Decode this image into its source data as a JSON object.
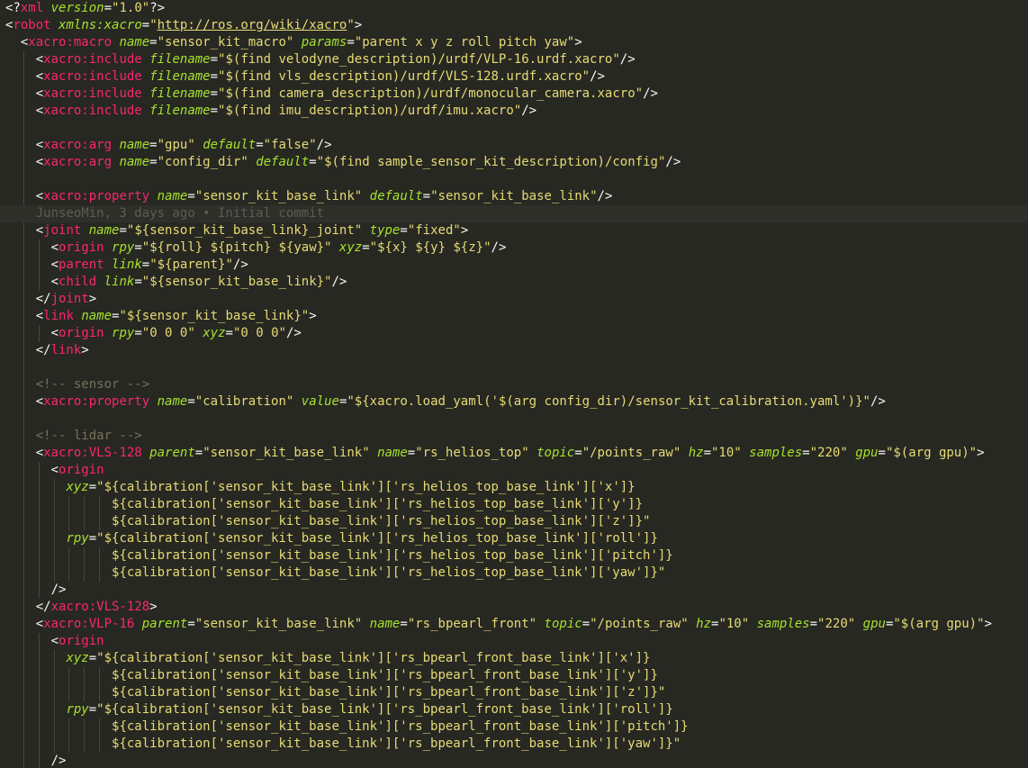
{
  "editor": {
    "file_type": "xacro",
    "colors": {
      "background": "#272822",
      "punctuation": "#f8f8f2",
      "tag": "#f92672",
      "attribute": "#a6e22e",
      "string": "#e6db74",
      "comment": "#75715e"
    },
    "lines": [
      {
        "indent": 0,
        "tokens": [
          [
            "pu",
            "<?"
          ],
          [
            "tag",
            "xml"
          ],
          [
            "pu",
            " "
          ],
          [
            "attr",
            "version"
          ],
          [
            "pu",
            "="
          ],
          [
            "str",
            "\"1.0\""
          ],
          [
            "pu",
            "?>"
          ]
        ]
      },
      {
        "indent": 0,
        "tokens": [
          [
            "pu",
            "<"
          ],
          [
            "tag",
            "robot"
          ],
          [
            "pu",
            " "
          ],
          [
            "attr",
            "xmlns:xacro"
          ],
          [
            "pu",
            "="
          ],
          [
            "str",
            "\""
          ],
          [
            "url",
            "http://ros.org/wiki/xacro"
          ],
          [
            "str",
            "\""
          ],
          [
            "pu",
            ">"
          ]
        ]
      },
      {
        "indent": 1,
        "tokens": [
          [
            "pu",
            "<"
          ],
          [
            "tag",
            "xacro:macro"
          ],
          [
            "pu",
            " "
          ],
          [
            "attr",
            "name"
          ],
          [
            "pu",
            "="
          ],
          [
            "str",
            "\"sensor_kit_macro\""
          ],
          [
            "pu",
            " "
          ],
          [
            "attr",
            "params"
          ],
          [
            "pu",
            "="
          ],
          [
            "str",
            "\"parent x y z roll pitch yaw\""
          ],
          [
            "pu",
            ">"
          ]
        ]
      },
      {
        "indent": 2,
        "tokens": [
          [
            "pu",
            "<"
          ],
          [
            "tag",
            "xacro:include"
          ],
          [
            "pu",
            " "
          ],
          [
            "attr",
            "filename"
          ],
          [
            "pu",
            "="
          ],
          [
            "str",
            "\"$(find velodyne_description)/urdf/VLP-16.urdf.xacro\""
          ],
          [
            "pu",
            "/>"
          ]
        ]
      },
      {
        "indent": 2,
        "tokens": [
          [
            "pu",
            "<"
          ],
          [
            "tag",
            "xacro:include"
          ],
          [
            "pu",
            " "
          ],
          [
            "attr",
            "filename"
          ],
          [
            "pu",
            "="
          ],
          [
            "str",
            "\"$(find vls_description)/urdf/VLS-128.urdf.xacro\""
          ],
          [
            "pu",
            "/>"
          ]
        ]
      },
      {
        "indent": 2,
        "tokens": [
          [
            "pu",
            "<"
          ],
          [
            "tag",
            "xacro:include"
          ],
          [
            "pu",
            " "
          ],
          [
            "attr",
            "filename"
          ],
          [
            "pu",
            "="
          ],
          [
            "str",
            "\"$(find camera_description)/urdf/monocular_camera.xacro\""
          ],
          [
            "pu",
            "/>"
          ]
        ]
      },
      {
        "indent": 2,
        "tokens": [
          [
            "pu",
            "<"
          ],
          [
            "tag",
            "xacro:include"
          ],
          [
            "pu",
            " "
          ],
          [
            "attr",
            "filename"
          ],
          [
            "pu",
            "="
          ],
          [
            "str",
            "\"$(find imu_description)/urdf/imu.xacro\""
          ],
          [
            "pu",
            "/>"
          ]
        ]
      },
      {
        "indent": 2,
        "tokens": []
      },
      {
        "indent": 2,
        "tokens": [
          [
            "pu",
            "<"
          ],
          [
            "tag",
            "xacro:arg"
          ],
          [
            "pu",
            " "
          ],
          [
            "attr",
            "name"
          ],
          [
            "pu",
            "="
          ],
          [
            "str",
            "\"gpu\""
          ],
          [
            "pu",
            " "
          ],
          [
            "attr",
            "default"
          ],
          [
            "pu",
            "="
          ],
          [
            "str",
            "\"false\""
          ],
          [
            "pu",
            "/>"
          ]
        ]
      },
      {
        "indent": 2,
        "tokens": [
          [
            "pu",
            "<"
          ],
          [
            "tag",
            "xacro:arg"
          ],
          [
            "pu",
            " "
          ],
          [
            "attr",
            "name"
          ],
          [
            "pu",
            "="
          ],
          [
            "str",
            "\"config_dir\""
          ],
          [
            "pu",
            " "
          ],
          [
            "attr",
            "default"
          ],
          [
            "pu",
            "="
          ],
          [
            "str",
            "\"$(find sample_sensor_kit_description)/config\""
          ],
          [
            "pu",
            "/>"
          ]
        ]
      },
      {
        "indent": 2,
        "tokens": []
      },
      {
        "indent": 2,
        "tokens": [
          [
            "pu",
            "<"
          ],
          [
            "tag",
            "xacro:property"
          ],
          [
            "pu",
            " "
          ],
          [
            "attr",
            "name"
          ],
          [
            "pu",
            "="
          ],
          [
            "str",
            "\"sensor_kit_base_link\""
          ],
          [
            "pu",
            " "
          ],
          [
            "attr",
            "default"
          ],
          [
            "pu",
            "="
          ],
          [
            "str",
            "\"sensor_kit_base_link\""
          ],
          [
            "pu",
            "/>"
          ]
        ]
      },
      {
        "indent": 1,
        "highlight": true,
        "tokens": [
          [
            "blame",
            "  JunseoMin, 3 days ago • Initial commit"
          ]
        ]
      },
      {
        "indent": 2,
        "tokens": [
          [
            "pu",
            "<"
          ],
          [
            "tag",
            "joint"
          ],
          [
            "pu",
            " "
          ],
          [
            "attr",
            "name"
          ],
          [
            "pu",
            "="
          ],
          [
            "str",
            "\"${sensor_kit_base_link}_joint\""
          ],
          [
            "pu",
            " "
          ],
          [
            "attr",
            "type"
          ],
          [
            "pu",
            "="
          ],
          [
            "str",
            "\"fixed\""
          ],
          [
            "pu",
            ">"
          ]
        ]
      },
      {
        "indent": 3,
        "tokens": [
          [
            "pu",
            "<"
          ],
          [
            "tag",
            "origin"
          ],
          [
            "pu",
            " "
          ],
          [
            "attr",
            "rpy"
          ],
          [
            "pu",
            "="
          ],
          [
            "str",
            "\"${roll} ${pitch} ${yaw}\""
          ],
          [
            "pu",
            " "
          ],
          [
            "attr",
            "xyz"
          ],
          [
            "pu",
            "="
          ],
          [
            "str",
            "\"${x} ${y} ${z}\""
          ],
          [
            "pu",
            "/>"
          ]
        ]
      },
      {
        "indent": 3,
        "tokens": [
          [
            "pu",
            "<"
          ],
          [
            "tag",
            "parent"
          ],
          [
            "pu",
            " "
          ],
          [
            "attr",
            "link"
          ],
          [
            "pu",
            "="
          ],
          [
            "str",
            "\"${parent}\""
          ],
          [
            "pu",
            "/>"
          ]
        ]
      },
      {
        "indent": 3,
        "tokens": [
          [
            "pu",
            "<"
          ],
          [
            "tag",
            "child"
          ],
          [
            "pu",
            " "
          ],
          [
            "attr",
            "link"
          ],
          [
            "pu",
            "="
          ],
          [
            "str",
            "\"${sensor_kit_base_link}\""
          ],
          [
            "pu",
            "/>"
          ]
        ]
      },
      {
        "indent": 2,
        "tokens": [
          [
            "pu",
            "</"
          ],
          [
            "tag",
            "joint"
          ],
          [
            "pu",
            ">"
          ]
        ]
      },
      {
        "indent": 2,
        "tokens": [
          [
            "pu",
            "<"
          ],
          [
            "tag",
            "link"
          ],
          [
            "pu",
            " "
          ],
          [
            "attr",
            "name"
          ],
          [
            "pu",
            "="
          ],
          [
            "str",
            "\"${sensor_kit_base_link}\""
          ],
          [
            "pu",
            ">"
          ]
        ]
      },
      {
        "indent": 3,
        "tokens": [
          [
            "pu",
            "<"
          ],
          [
            "tag",
            "origin"
          ],
          [
            "pu",
            " "
          ],
          [
            "attr",
            "rpy"
          ],
          [
            "pu",
            "="
          ],
          [
            "str",
            "\"0 0 0\""
          ],
          [
            "pu",
            " "
          ],
          [
            "attr",
            "xyz"
          ],
          [
            "pu",
            "="
          ],
          [
            "str",
            "\"0 0 0\""
          ],
          [
            "pu",
            "/>"
          ]
        ]
      },
      {
        "indent": 2,
        "tokens": [
          [
            "pu",
            "</"
          ],
          [
            "tag",
            "link"
          ],
          [
            "pu",
            ">"
          ]
        ]
      },
      {
        "indent": 2,
        "tokens": []
      },
      {
        "indent": 2,
        "tokens": [
          [
            "cmt",
            "<!-- sensor -->"
          ]
        ]
      },
      {
        "indent": 2,
        "tokens": [
          [
            "pu",
            "<"
          ],
          [
            "tag",
            "xacro:property"
          ],
          [
            "pu",
            " "
          ],
          [
            "attr",
            "name"
          ],
          [
            "pu",
            "="
          ],
          [
            "str",
            "\"calibration\""
          ],
          [
            "pu",
            " "
          ],
          [
            "attr",
            "value"
          ],
          [
            "pu",
            "="
          ],
          [
            "str",
            "\"${xacro.load_yaml('$(arg config_dir)/sensor_kit_calibration.yaml')}\""
          ],
          [
            "pu",
            "/>"
          ]
        ]
      },
      {
        "indent": 2,
        "tokens": []
      },
      {
        "indent": 2,
        "tokens": [
          [
            "cmt",
            "<!-- lidar -->"
          ]
        ]
      },
      {
        "indent": 2,
        "tokens": [
          [
            "pu",
            "<"
          ],
          [
            "tag",
            "xacro:VLS-128"
          ],
          [
            "pu",
            " "
          ],
          [
            "attr",
            "parent"
          ],
          [
            "pu",
            "="
          ],
          [
            "str",
            "\"sensor_kit_base_link\""
          ],
          [
            "pu",
            " "
          ],
          [
            "attr",
            "name"
          ],
          [
            "pu",
            "="
          ],
          [
            "str",
            "\"rs_helios_top\""
          ],
          [
            "pu",
            " "
          ],
          [
            "attr",
            "topic"
          ],
          [
            "pu",
            "="
          ],
          [
            "str",
            "\"/points_raw\""
          ],
          [
            "pu",
            " "
          ],
          [
            "attr",
            "hz"
          ],
          [
            "pu",
            "="
          ],
          [
            "str",
            "\"10\""
          ],
          [
            "pu",
            " "
          ],
          [
            "attr",
            "samples"
          ],
          [
            "pu",
            "="
          ],
          [
            "str",
            "\"220\""
          ],
          [
            "pu",
            " "
          ],
          [
            "attr",
            "gpu"
          ],
          [
            "pu",
            "="
          ],
          [
            "str",
            "\"$(arg gpu)\""
          ],
          [
            "pu",
            ">"
          ]
        ]
      },
      {
        "indent": 3,
        "tokens": [
          [
            "pu",
            "<"
          ],
          [
            "tag",
            "origin"
          ]
        ]
      },
      {
        "indent": 4,
        "tokens": [
          [
            "attr",
            "xyz"
          ],
          [
            "pu",
            "="
          ],
          [
            "str",
            "\"${calibration['sensor_kit_base_link']['rs_helios_top_base_link']['x']}"
          ]
        ]
      },
      {
        "indent": 7,
        "tokens": [
          [
            "str",
            "${calibration['sensor_kit_base_link']['rs_helios_top_base_link']['y']}"
          ]
        ]
      },
      {
        "indent": 7,
        "tokens": [
          [
            "str",
            "${calibration['sensor_kit_base_link']['rs_helios_top_base_link']['z']}\""
          ]
        ]
      },
      {
        "indent": 4,
        "tokens": [
          [
            "attr",
            "rpy"
          ],
          [
            "pu",
            "="
          ],
          [
            "str",
            "\"${calibration['sensor_kit_base_link']['rs_helios_top_base_link']['roll']}"
          ]
        ]
      },
      {
        "indent": 7,
        "tokens": [
          [
            "str",
            "${calibration['sensor_kit_base_link']['rs_helios_top_base_link']['pitch']}"
          ]
        ]
      },
      {
        "indent": 7,
        "tokens": [
          [
            "str",
            "${calibration['sensor_kit_base_link']['rs_helios_top_base_link']['yaw']}\""
          ]
        ]
      },
      {
        "indent": 3,
        "tokens": [
          [
            "pu",
            "/>"
          ]
        ]
      },
      {
        "indent": 2,
        "tokens": [
          [
            "pu",
            "</"
          ],
          [
            "tag",
            "xacro:VLS-128"
          ],
          [
            "pu",
            ">"
          ]
        ]
      },
      {
        "indent": 2,
        "tokens": [
          [
            "pu",
            "<"
          ],
          [
            "tag",
            "xacro:VLP-16"
          ],
          [
            "pu",
            " "
          ],
          [
            "attr",
            "parent"
          ],
          [
            "pu",
            "="
          ],
          [
            "str",
            "\"sensor_kit_base_link\""
          ],
          [
            "pu",
            " "
          ],
          [
            "attr",
            "name"
          ],
          [
            "pu",
            "="
          ],
          [
            "str",
            "\"rs_bpearl_front\""
          ],
          [
            "pu",
            " "
          ],
          [
            "attr",
            "topic"
          ],
          [
            "pu",
            "="
          ],
          [
            "str",
            "\"/points_raw\""
          ],
          [
            "pu",
            " "
          ],
          [
            "attr",
            "hz"
          ],
          [
            "pu",
            "="
          ],
          [
            "str",
            "\"10\""
          ],
          [
            "pu",
            " "
          ],
          [
            "attr",
            "samples"
          ],
          [
            "pu",
            "="
          ],
          [
            "str",
            "\"220\""
          ],
          [
            "pu",
            " "
          ],
          [
            "attr",
            "gpu"
          ],
          [
            "pu",
            "="
          ],
          [
            "str",
            "\"$(arg gpu)\""
          ],
          [
            "pu",
            ">"
          ]
        ]
      },
      {
        "indent": 3,
        "tokens": [
          [
            "pu",
            "<"
          ],
          [
            "tag",
            "origin"
          ]
        ]
      },
      {
        "indent": 4,
        "tokens": [
          [
            "attr",
            "xyz"
          ],
          [
            "pu",
            "="
          ],
          [
            "str",
            "\"${calibration['sensor_kit_base_link']['rs_bpearl_front_base_link']['x']}"
          ]
        ]
      },
      {
        "indent": 7,
        "tokens": [
          [
            "str",
            "${calibration['sensor_kit_base_link']['rs_bpearl_front_base_link']['y']}"
          ]
        ]
      },
      {
        "indent": 7,
        "tokens": [
          [
            "str",
            "${calibration['sensor_kit_base_link']['rs_bpearl_front_base_link']['z']}\""
          ]
        ]
      },
      {
        "indent": 4,
        "tokens": [
          [
            "attr",
            "rpy"
          ],
          [
            "pu",
            "="
          ],
          [
            "str",
            "\"${calibration['sensor_kit_base_link']['rs_bpearl_front_base_link']['roll']}"
          ]
        ]
      },
      {
        "indent": 7,
        "tokens": [
          [
            "str",
            "${calibration['sensor_kit_base_link']['rs_bpearl_front_base_link']['pitch']}"
          ]
        ]
      },
      {
        "indent": 7,
        "tokens": [
          [
            "str",
            "${calibration['sensor_kit_base_link']['rs_bpearl_front_base_link']['yaw']}\""
          ]
        ]
      },
      {
        "indent": 3,
        "tokens": [
          [
            "pu",
            "/>"
          ]
        ]
      }
    ]
  }
}
